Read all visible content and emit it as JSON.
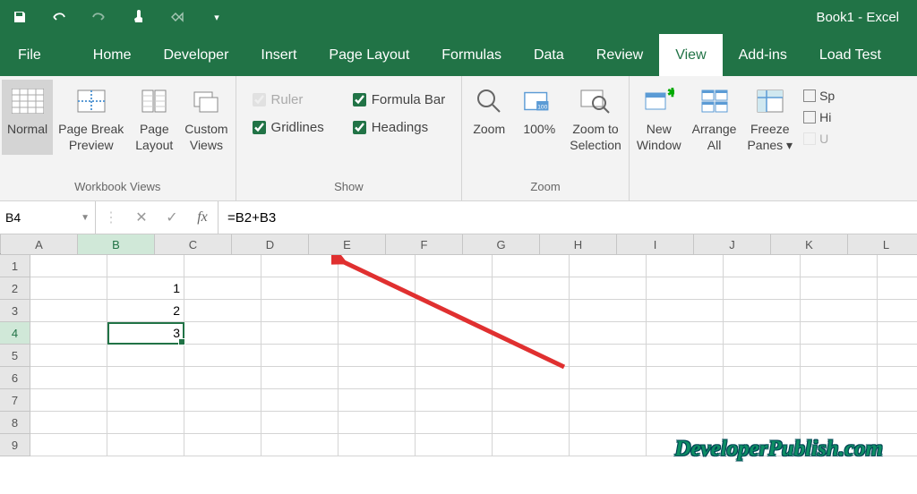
{
  "app": {
    "title": "Book1 - Excel"
  },
  "tabs": {
    "file": "File",
    "items": [
      "Home",
      "Developer",
      "Insert",
      "Page Layout",
      "Formulas",
      "Data",
      "Review",
      "View",
      "Add-ins",
      "Load Test"
    ],
    "active": "View"
  },
  "ribbon": {
    "workbook_views": {
      "label": "Workbook Views",
      "normal": "Normal",
      "page_break": "Page Break\nPreview",
      "page_layout": "Page\nLayout",
      "custom_views": "Custom\nViews"
    },
    "show": {
      "label": "Show",
      "ruler": "Ruler",
      "formula_bar": "Formula Bar",
      "gridlines": "Gridlines",
      "headings": "Headings"
    },
    "zoom": {
      "label": "Zoom",
      "zoom": "Zoom",
      "hundred": "100%",
      "selection": "Zoom to\nSelection"
    },
    "window": {
      "new_window": "New\nWindow",
      "arrange_all": "Arrange\nAll",
      "freeze_panes": "Freeze\nPanes ▾"
    },
    "side": {
      "split": "Sp",
      "hide": "Hi",
      "unhide": "U"
    }
  },
  "formulabar": {
    "namebox": "B4",
    "formula": "=B2+B3"
  },
  "grid": {
    "columns": [
      "A",
      "B",
      "C",
      "D",
      "E",
      "F",
      "G",
      "H",
      "I",
      "J",
      "K",
      "L"
    ],
    "rows": 9,
    "active_col": "B",
    "active_row": 4,
    "cells": {
      "B2": "1",
      "B3": "2",
      "B4": "3"
    }
  },
  "watermark": "DeveloperPublish.com"
}
